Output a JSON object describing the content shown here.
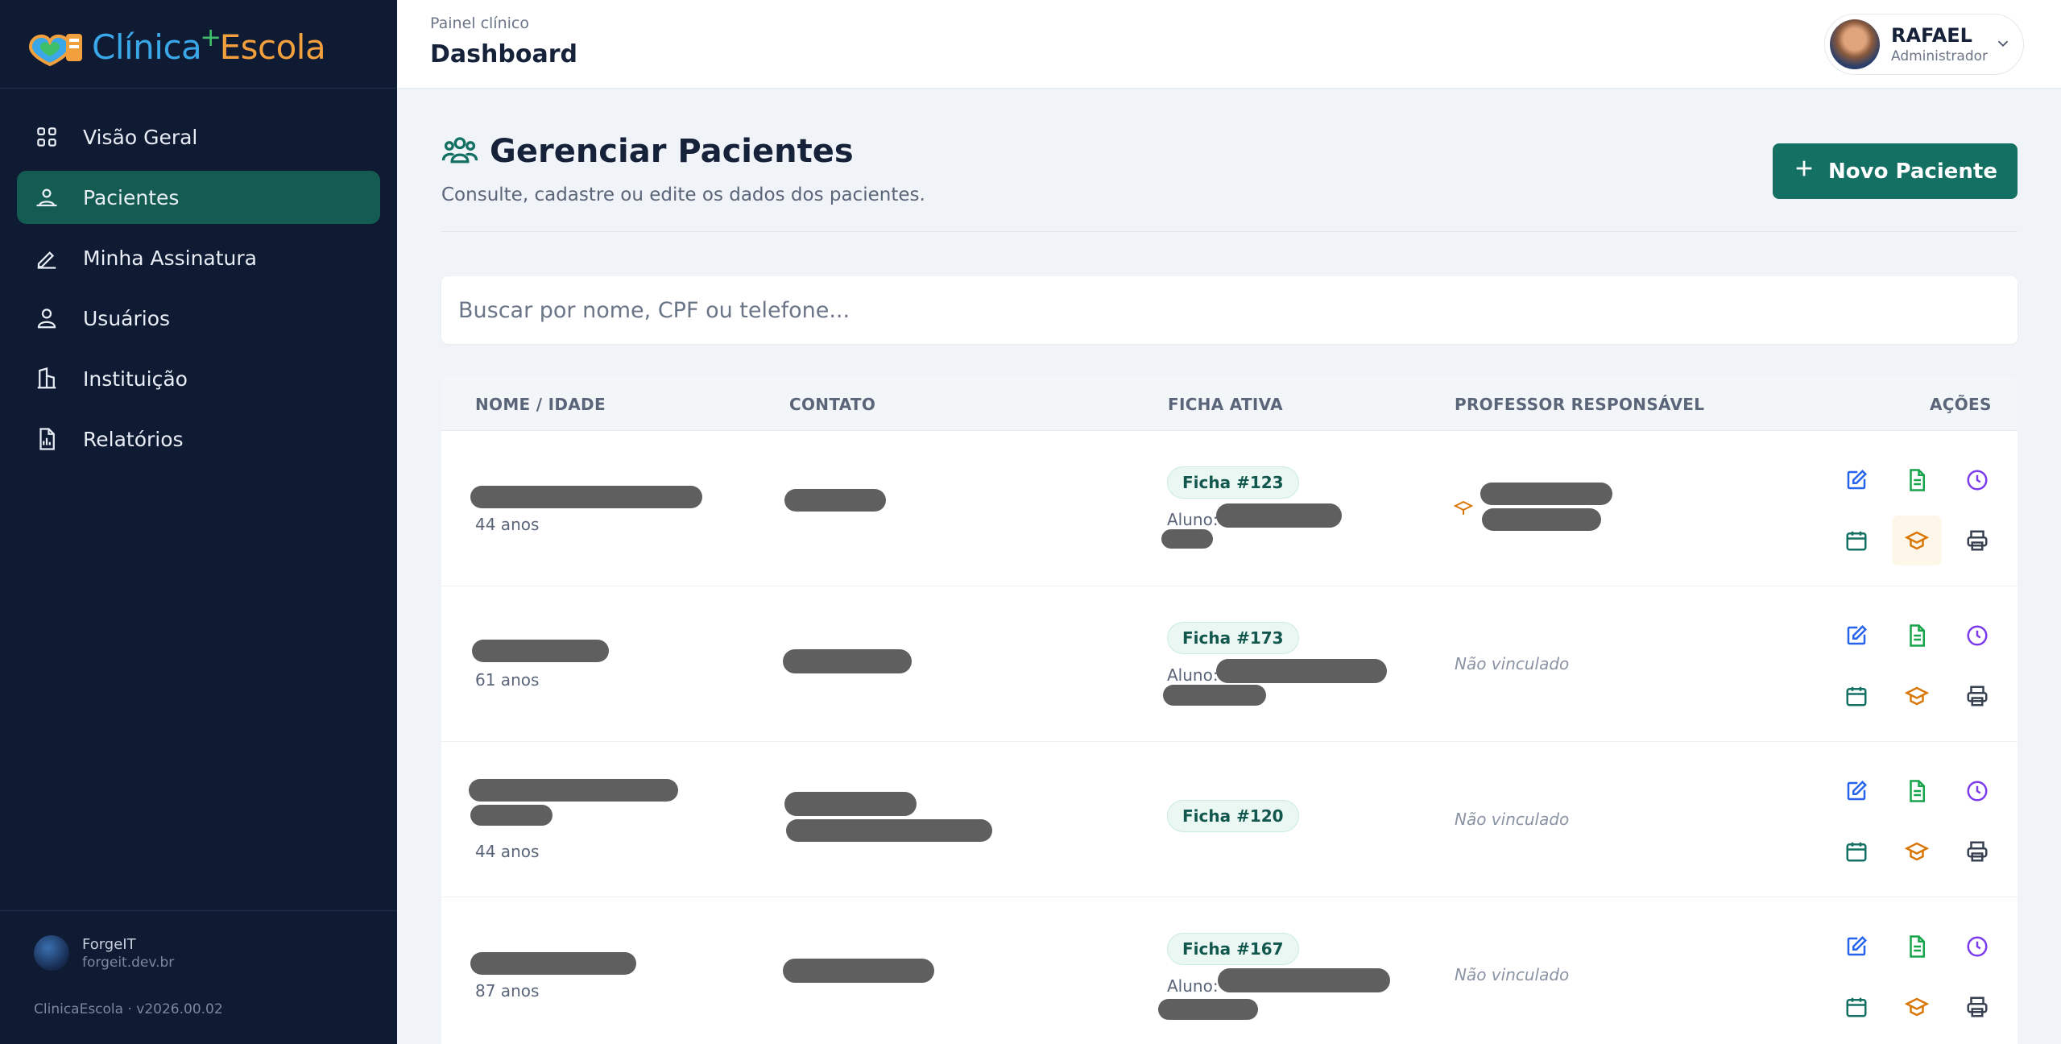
{
  "brand": {
    "part1": "Clínica",
    "part2": "Escola",
    "plus": "+"
  },
  "nav": [
    {
      "label": "Visão Geral",
      "icon": "grid-icon"
    },
    {
      "label": "Pacientes",
      "icon": "patients-icon",
      "active": true
    },
    {
      "label": "Minha Assinatura",
      "icon": "pen-icon"
    },
    {
      "label": "Usuários",
      "icon": "user-icon"
    },
    {
      "label": "Instituição",
      "icon": "building-icon"
    },
    {
      "label": "Relatórios",
      "icon": "report-icon"
    }
  ],
  "footer": {
    "company": "ForgeIT",
    "url": "forgeit.dev.br",
    "version": "ClinicaEscola · v2026.00.02"
  },
  "header": {
    "breadcrumb": "Painel clínico",
    "title": "Dashboard",
    "user_name": "RAFAEL",
    "user_role": "Administrador"
  },
  "main": {
    "title": "Gerenciar Pacientes",
    "subtitle": "Consulte, cadastre ou edite os dados dos pacientes.",
    "new_button": "Novo Paciente",
    "search_placeholder": "Buscar por nome, CPF ou telefone..."
  },
  "table": {
    "headers": [
      "NOME / IDADE",
      "CONTATO",
      "FICHA ATIVA",
      "PROFESSOR RESPONSÁVEL",
      "AÇÕES"
    ],
    "rows": [
      {
        "age": "44 anos",
        "ficha": "Ficha #123",
        "aluno_label": "Aluno:",
        "professor": ""
      },
      {
        "age": "61 anos",
        "ficha": "Ficha #173",
        "aluno_label": "Aluno:",
        "professor": "Não vinculado"
      },
      {
        "age": "44 anos",
        "ficha": "Ficha #120",
        "aluno_label": "",
        "professor": "Não vinculado"
      },
      {
        "age": "87 anos",
        "ficha": "Ficha #167",
        "aluno_label": "Aluno:",
        "professor": "Não vinculado"
      }
    ]
  },
  "colors": {
    "sidebar": "#0f1a33",
    "accent": "#137063",
    "edit": "#2563eb",
    "doc": "#16a34a",
    "history": "#7c3aed",
    "calendar": "#137063",
    "cap": "#d97706",
    "print": "#374151"
  }
}
